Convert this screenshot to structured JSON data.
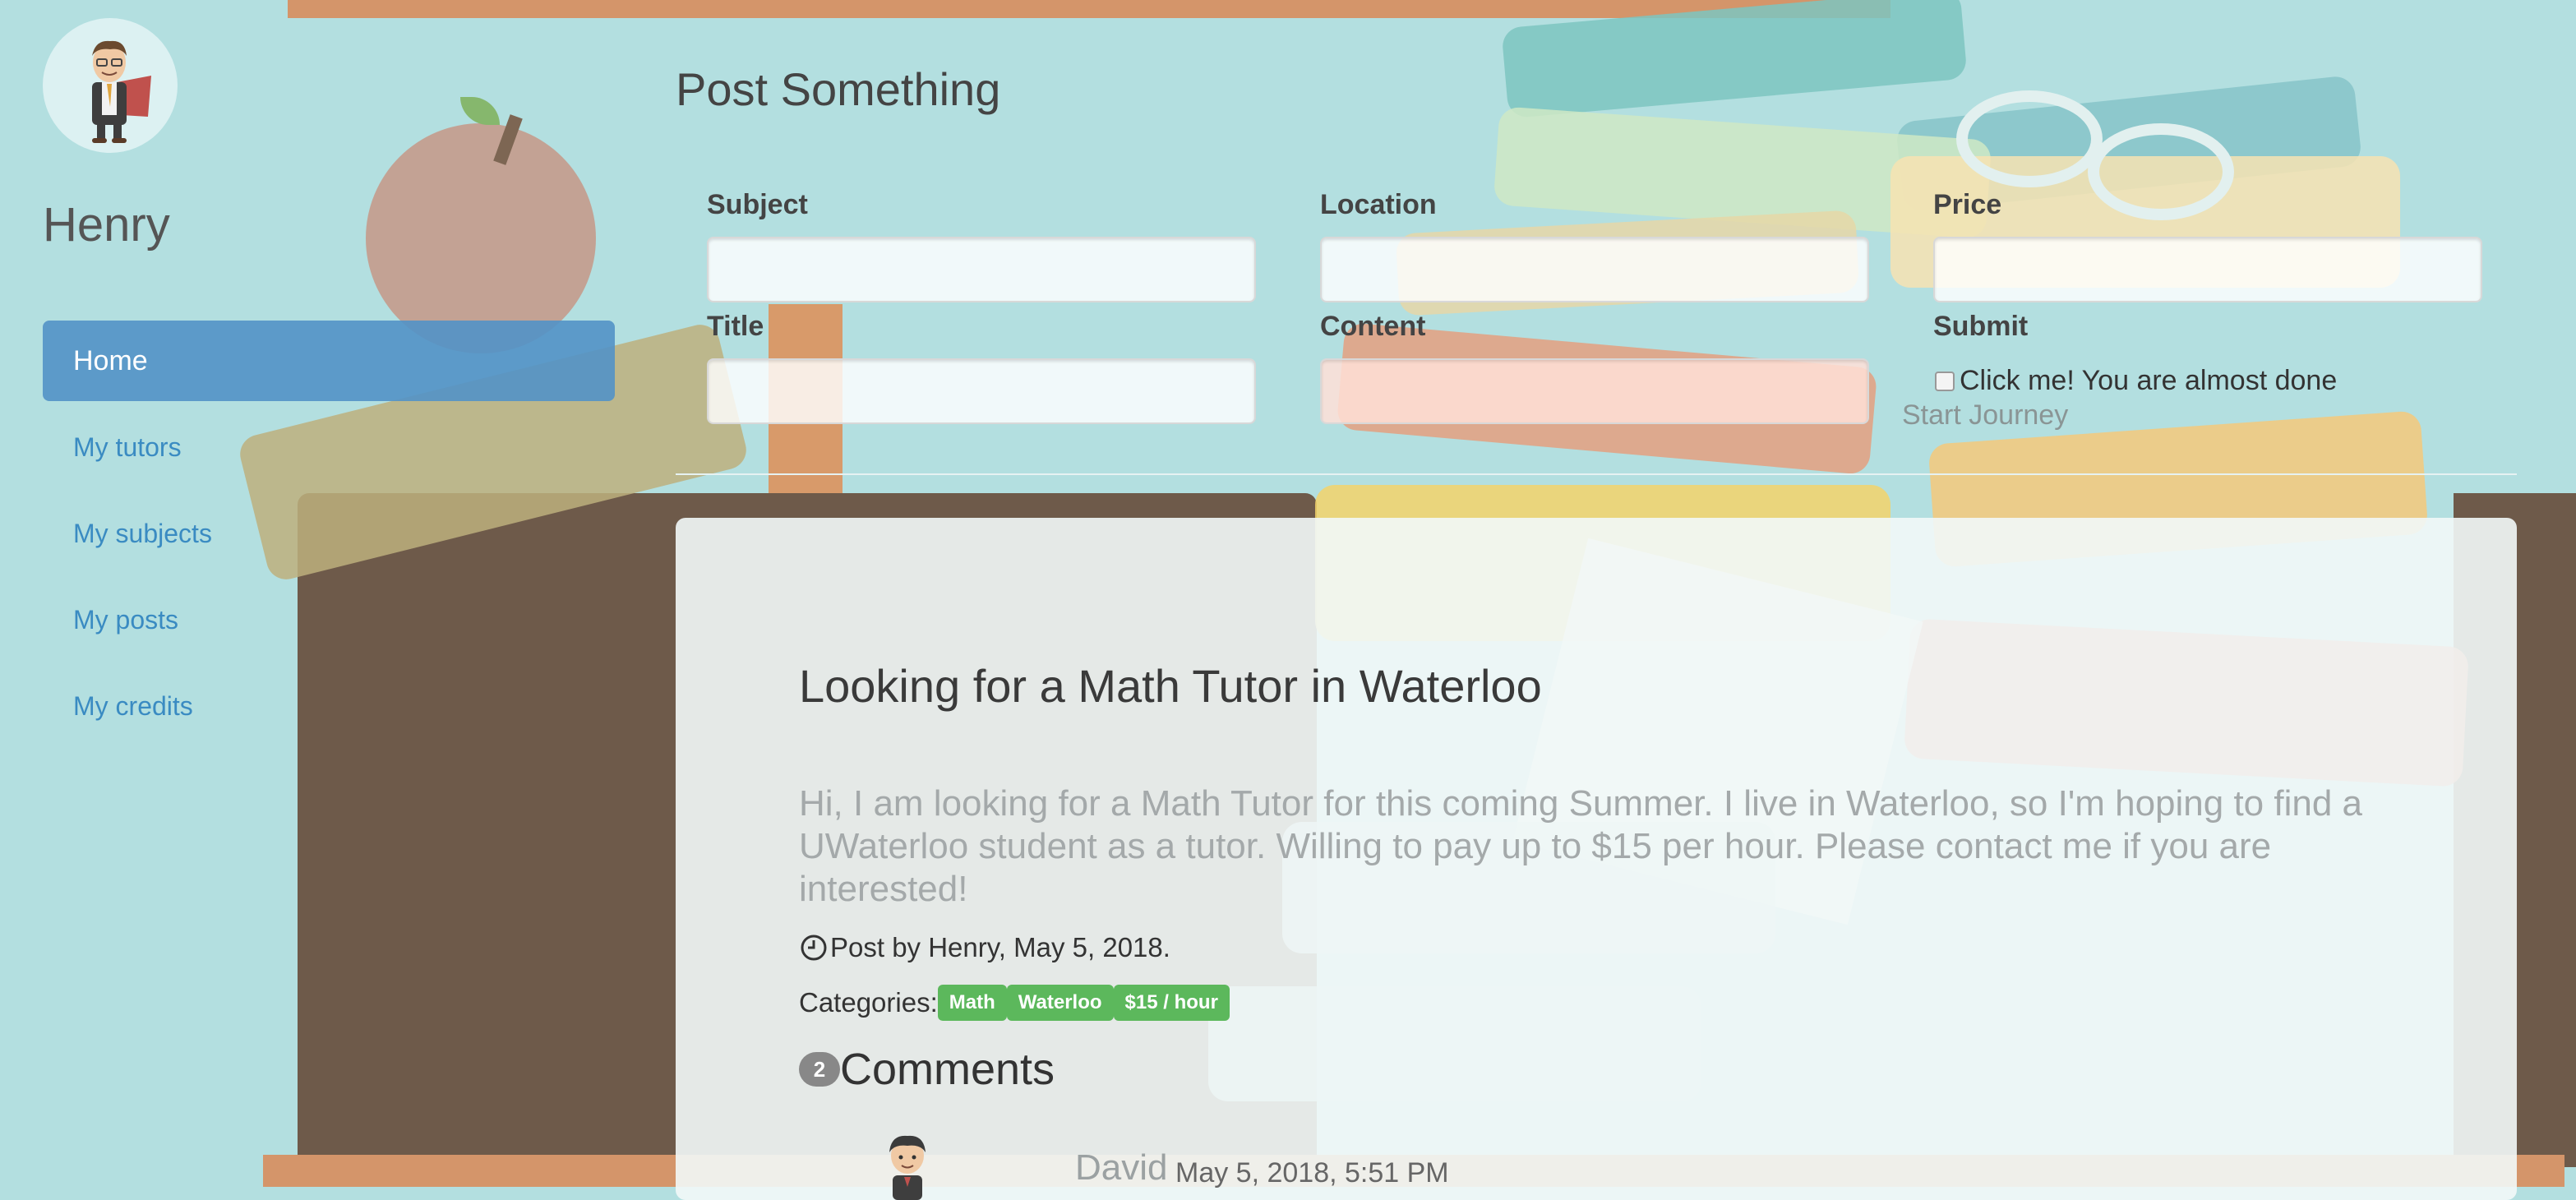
{
  "user": {
    "name": "Henry"
  },
  "sidebar": {
    "items": [
      {
        "label": "Home",
        "active": true
      },
      {
        "label": "My tutors",
        "active": false
      },
      {
        "label": "My subjects",
        "active": false
      },
      {
        "label": "My posts",
        "active": false
      },
      {
        "label": "My credits",
        "active": false
      }
    ]
  },
  "form": {
    "title": "Post Something",
    "subject_label": "Subject",
    "location_label": "Location",
    "price_label": "Price",
    "title_label": "Title",
    "content_label": "Content",
    "submit_label": "Submit",
    "checkbox_label": "Click me! You are almost done",
    "checkbox_checked": false,
    "start_link": "Start Journey",
    "subject_value": "",
    "location_value": "",
    "price_value": "",
    "title_value": "",
    "content_value": ""
  },
  "post": {
    "title": "Looking for a Math Tutor in Waterloo",
    "body": "Hi, I am looking for a Math Tutor for this coming Summer. I live in Waterloo, so I'm hoping to find a UWaterloo student as a tutor. Willing to pay up to $15 per hour. Please contact me if you are interested!",
    "meta": "Post by Henry, May 5, 2018.",
    "categories_label": "Categories:",
    "categories": [
      "Math",
      "Waterloo",
      "$15 / hour"
    ],
    "comment_count": "2",
    "comments_label": "Comments",
    "comments": [
      {
        "author": "David",
        "time": "May 5, 2018, 5:51 PM"
      }
    ]
  },
  "colors": {
    "background": "#b3dfe0",
    "nav_active": "#5292c6",
    "nav_link": "#3a8bc2",
    "tag": "#5cb85c"
  },
  "icons": {
    "avatar": "user-avatar-cartoon",
    "clock": "clock-icon"
  }
}
